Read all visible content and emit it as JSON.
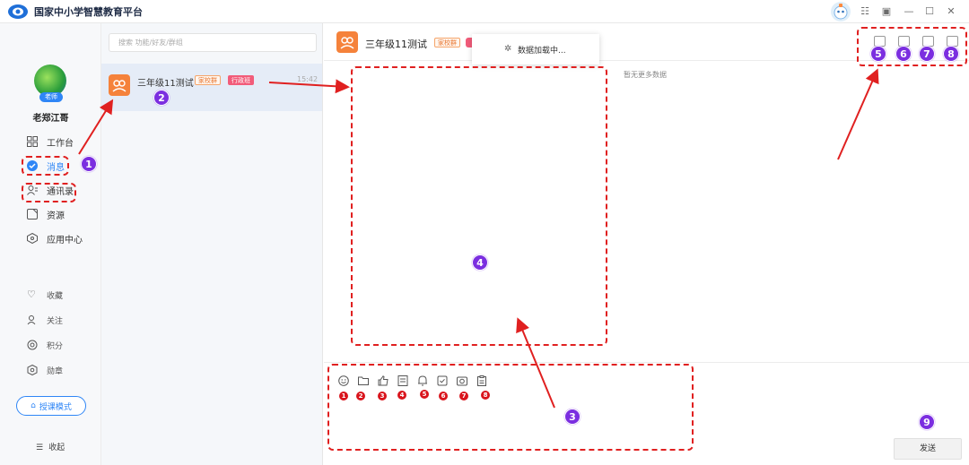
{
  "app": {
    "title": "国家中小学智慧教育平台"
  },
  "user": {
    "role_tag": "老师",
    "name": "老郑江哥"
  },
  "nav": {
    "items": [
      {
        "label": "工作台",
        "icon": "workbench-icon"
      },
      {
        "label": "消息",
        "icon": "message-icon",
        "active": true
      },
      {
        "label": "通讯录",
        "icon": "contacts-icon"
      },
      {
        "label": "资源",
        "icon": "resource-icon"
      },
      {
        "label": "应用中心",
        "icon": "app-center-icon"
      }
    ],
    "secondary": [
      {
        "label": "收藏",
        "icon": "heart-icon"
      },
      {
        "label": "关注",
        "icon": "follow-icon"
      },
      {
        "label": "积分",
        "icon": "points-icon"
      },
      {
        "label": "勋章",
        "icon": "medal-icon"
      }
    ],
    "lecture_mode": "授课模式",
    "collapse": "收起"
  },
  "search": {
    "placeholder": "搜索 功能/好友/群组"
  },
  "conversation": {
    "name": "三年级11测试",
    "tag_school": "家校群",
    "tag_admin": "行政班",
    "time": "15:42"
  },
  "chat": {
    "title": "三年级11测试",
    "tag_school": "家校群",
    "loading": "数据加载中...",
    "no_more": "暂无更多数据",
    "send": "发送"
  },
  "annotations": {
    "badges": [
      "1",
      "2",
      "3",
      "4",
      "5",
      "6",
      "7",
      "8",
      "9"
    ],
    "tool_badges": [
      "1",
      "2",
      "3",
      "4",
      "5",
      "6",
      "7",
      "8"
    ]
  },
  "colors": {
    "accent": "#2f86f6",
    "annotation_red": "#e02020",
    "badge_purple": "#7b2ee0",
    "group_orange": "#f5823b"
  }
}
